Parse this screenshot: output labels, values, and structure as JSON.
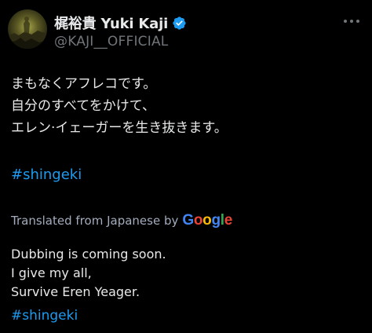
{
  "author": {
    "display_name": "梶裕貴 Yuki Kaji",
    "handle": "@KAJI__OFFICIAL",
    "verified": true,
    "verified_color": "#1d9bf0",
    "avatar_icon": "profile-photo"
  },
  "tweet": {
    "lines_jp": [
      "まもなくアフレコです。",
      "自分のすべてをかけて、",
      "エレン·イェーガーを生き抜きます。"
    ],
    "hashtag": "#shingeki"
  },
  "translation": {
    "label": "Translated from Japanese by",
    "provider_letters": [
      "G",
      "o",
      "o",
      "g",
      "l",
      "e"
    ],
    "provider_colors": [
      "#4285f4",
      "#ea4335",
      "#fbbc05",
      "#4285f4",
      "#34a853",
      "#ea4335"
    ],
    "lines_en": [
      "Dubbing is coming soon.",
      "I give my all,",
      "Survive Eren Yeager."
    ],
    "hashtag": "#shingeki"
  },
  "colors": {
    "background": "#000000",
    "text": "#e7e9ea",
    "secondary_text": "#71767b",
    "link": "#1d9bf0"
  }
}
